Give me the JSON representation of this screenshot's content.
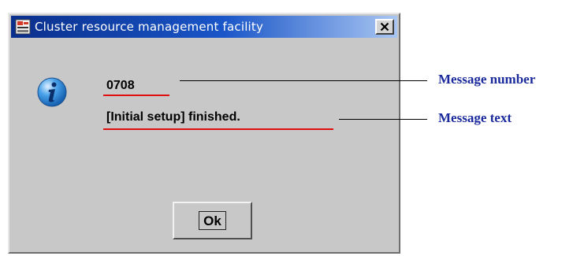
{
  "dialog": {
    "title": "Cluster resource management facility",
    "close_symbol": "✕",
    "message_number": "0708",
    "message_text": "[Initial setup]  finished.",
    "ok_label": "Ok",
    "info_icon": "info-icon",
    "app_icon": "app-window-icon"
  },
  "annotations": {
    "message_number_label": "Message number",
    "message_text_label": "Message text"
  },
  "colors": {
    "underline": "#e01010",
    "annotation_text": "#1a2a9c",
    "titlebar_start": "#0a2f8c",
    "titlebar_end": "#a9c6f2"
  }
}
